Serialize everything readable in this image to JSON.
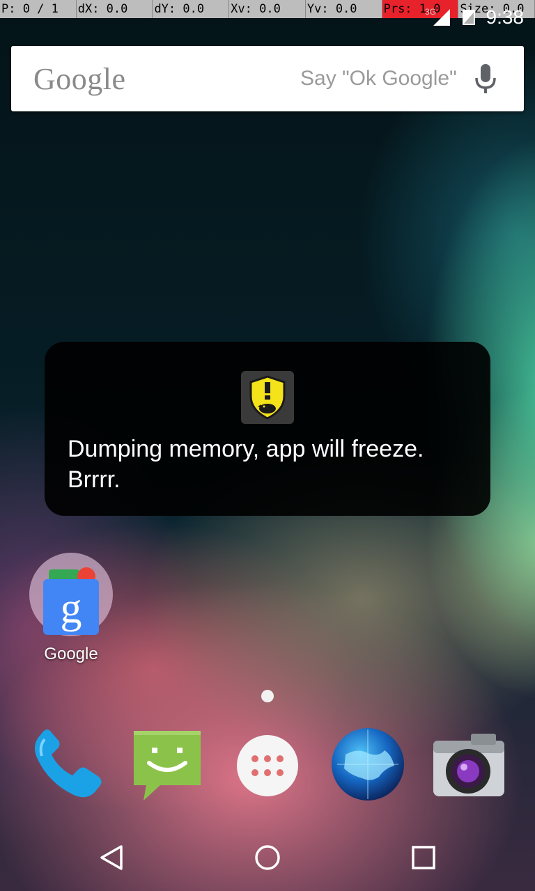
{
  "debug": {
    "cells": [
      {
        "text": "P: 0 / 1"
      },
      {
        "text": "dX: 0.0"
      },
      {
        "text": "dY: 0.0"
      },
      {
        "text": "Xv: 0.0"
      },
      {
        "text": "Yv: 0.0"
      },
      {
        "text": "Prs: 1.0"
      },
      {
        "text": "Size: 0.0"
      }
    ]
  },
  "status": {
    "time": "9:38",
    "network": "3G",
    "icons": [
      "signal-icon",
      "data-icon"
    ]
  },
  "search": {
    "logo": "Google",
    "hint": "Say \"Ok Google\"",
    "icon": "mic-icon"
  },
  "toast": {
    "message": "Dumping memory, app will freeze. Brrrr.",
    "icon": "leakcanary-shield-icon",
    "icon_color": "#f4e21b"
  },
  "home": {
    "folder_label": "Google",
    "folder_icon": "google-search-icon"
  },
  "dock": {
    "apps": [
      "phone-icon",
      "messaging-icon",
      "app-drawer-icon",
      "browser-icon",
      "camera-icon"
    ]
  },
  "nav": {
    "buttons": [
      "back-button",
      "home-button",
      "recents-button"
    ]
  }
}
